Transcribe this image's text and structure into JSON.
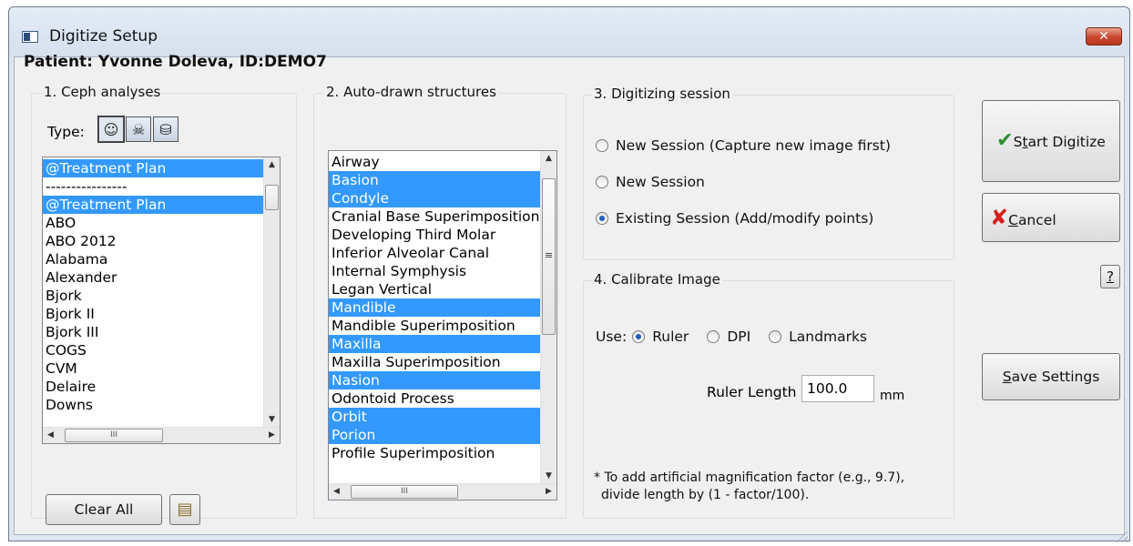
{
  "window": {
    "title": "Digitize Setup",
    "close_label": "✕"
  },
  "patient": "Patient: Yvonne Doleva, ID:DEMO7",
  "ceph": {
    "label": "1. Ceph analyses",
    "type_label": "Type:",
    "type_icons": [
      "face-profile-icon",
      "skull-icon",
      "tooth-icon"
    ],
    "items": [
      "@Treatment Plan",
      "----------------",
      "@Treatment Plan",
      "ABO",
      "ABO 2012",
      "Alabama",
      "Alexander",
      "Bjork",
      "Bjork II",
      "Bjork III",
      "COGS",
      "CVM",
      "Delaire",
      "Downs"
    ],
    "selected": [
      0,
      2
    ],
    "clear_label": "Clear All",
    "scroll_grip": "III"
  },
  "structures": {
    "label": "2. Auto-drawn structures",
    "items": [
      "Airway",
      "Basion",
      "Condyle",
      "Cranial Base Superimposition",
      "Developing Third Molar",
      "Inferior Alveolar Canal",
      "Internal Symphysis",
      "Legan Vertical",
      "Mandible",
      "Mandible Superimposition",
      "Maxilla",
      "Maxilla Superimposition",
      "Nasion",
      "Odontoid Process",
      "Orbit",
      "Porion",
      "Profile Superimposition"
    ],
    "selected": [
      1,
      2,
      8,
      10,
      12,
      14,
      15
    ],
    "scroll_grip": "III"
  },
  "session": {
    "label": "3. Digitizing session",
    "options": [
      "New Session (Capture new image first)",
      "New Session",
      "Existing Session (Add/modify points)"
    ],
    "selected": 2
  },
  "calibrate": {
    "label": "4. Calibrate Image",
    "use_label": "Use:",
    "options": [
      "Ruler",
      "DPI",
      "Landmarks"
    ],
    "selected": 0,
    "ruler_label": "Ruler Length",
    "ruler_value": "100.0",
    "unit": "mm",
    "note_line1": "* To add artificial magnification factor (e.g., 9.7),",
    "note_line2": "divide length by (1 - factor/100)."
  },
  "buttons": {
    "start_pre": "S",
    "start_u": "t",
    "start_post": "art Digitize",
    "cancel_u": "C",
    "cancel_post": "ancel",
    "help": "?",
    "save_u": "S",
    "save_post": "ave Settings"
  },
  "colors": {
    "selection": "#3399ff",
    "check": "#2e8b2e",
    "cross": "#d42020"
  }
}
